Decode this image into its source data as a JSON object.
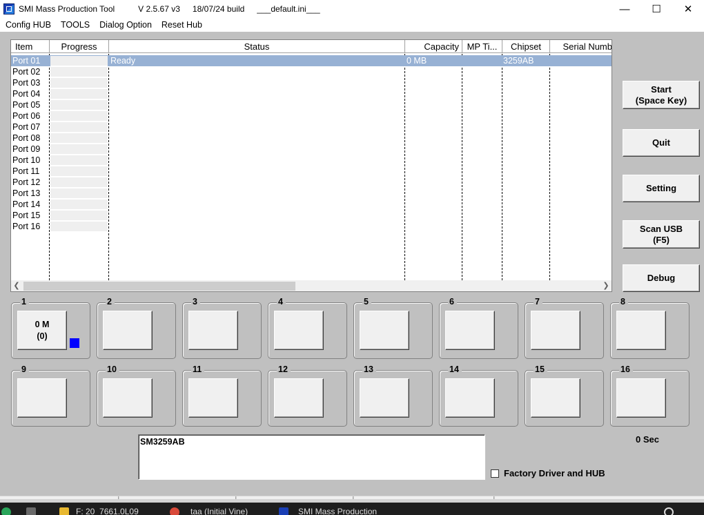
{
  "window": {
    "title_app": "SMI Mass Production Tool",
    "title_version": "V 2.5.67   v3",
    "title_build": "18/07/24 build",
    "title_ini": "___default.ini___",
    "minimize": "—",
    "maximize": "☐",
    "close": "✕"
  },
  "menu": [
    "Config HUB",
    "TOOLS",
    "Dialog Option",
    "Reset Hub"
  ],
  "table": {
    "columns": [
      "Item",
      "Progress",
      "Status",
      "Capacity",
      "MP Ti...",
      "Chipset",
      "Serial Numb"
    ],
    "ports": [
      "Port 01",
      "Port 02",
      "Port 03",
      "Port 04",
      "Port 05",
      "Port 06",
      "Port 07",
      "Port 08",
      "Port 09",
      "Port 10",
      "Port 11",
      "Port 12",
      "Port 13",
      "Port 14",
      "Port 15",
      "Port 16"
    ],
    "row1": {
      "status": "Ready",
      "capacity": "0 MB",
      "mp_time": "",
      "chipset": "3259AB",
      "serial": ""
    },
    "selected_row": "Port 01"
  },
  "buttons": {
    "start": "Start\n(Space Key)",
    "quit": "Quit",
    "setting": "Setting",
    "scan": "Scan USB\n(F5)",
    "debug": "Debug"
  },
  "panels": [
    {
      "num": "1",
      "line1": "0 M",
      "line2": "(0)",
      "led_color": "#0000ff"
    },
    {
      "num": "2"
    },
    {
      "num": "3"
    },
    {
      "num": "4"
    },
    {
      "num": "5"
    },
    {
      "num": "6"
    },
    {
      "num": "7"
    },
    {
      "num": "8"
    },
    {
      "num": "9"
    },
    {
      "num": "10"
    },
    {
      "num": "11"
    },
    {
      "num": "12"
    },
    {
      "num": "13"
    },
    {
      "num": "14"
    },
    {
      "num": "15"
    },
    {
      "num": "16"
    }
  ],
  "chip_text": "SM3259AB",
  "timer": "0 Sec",
  "factory_label": "Factory Driver and HUB",
  "factory_checked": false,
  "taskbar": {
    "item1": "F: 20_7661.0L09",
    "item2": "taa (Initial Vine)",
    "item3": "SMI Mass Production"
  }
}
